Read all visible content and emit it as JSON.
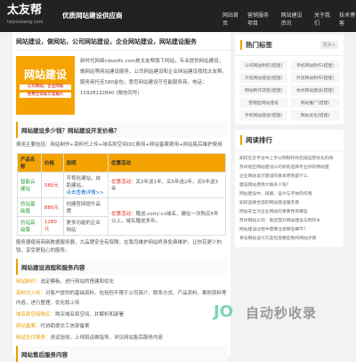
{
  "header": {
    "logo_main": "太友帮",
    "logo_sub": "taiyoubang.com",
    "slogan": "优质网站建设供应商",
    "nav": [
      "网站首页",
      "||",
      "营销服务项目",
      "▾",
      "|",
      "网站建设资讯",
      "|",
      "关于我们",
      "|",
      "技术博客"
    ]
  },
  "main": {
    "heading": "网站建设，做网站，公司网站建设，企业网站建设，网站建设服务",
    "ad": {
      "big": "网站建设",
      "small1": "公司网站，企业网站",
      "small2": "免费咨询拿方案报价"
    },
    "intro": "新时代网络cdsxdfc.com是太友帮旗下网站，专业提供网站建设，做网站等网站建设服务，公司网站建设和企业网站建设我找太友帮。服务用托至580金包，意您网站建设可任能服务商。电话： 15928132840  (微信同号)",
    "q1": "网站建设多少钱？网站建设开发价格？",
    "q1_text": "费用主要包括：网站制作+资料代上传+域名和空间IDC费用+网站备案费用+网站售后维护费用",
    "table": {
      "headers": [
        "产品名称",
        "价格",
        "说明",
        "优惠活动"
      ],
      "rows": [
        {
          "name": "智能云建站",
          "price": "580元",
          "desc1": "可视化建站，自助建站，",
          "desc2": "点击查看详情>>",
          "promo1": "优惠活动：",
          "promo2": "买2年送1年，买5年送2年，买5年送3年"
        },
        {
          "name": "仿站基础版",
          "price": "880元",
          "desc1": "创建官网提升品牌",
          "desc2": "",
          "promo1": "优惠活动：",
          "promo2": "赠送.com/.cn域名，建站一次购买5年以上，域名赠送多年。"
        },
        {
          "name": "仿站高级版",
          "price": "1280元",
          "desc1": "更多功能的企业网站",
          "desc2": "",
          "promo1": "",
          "promo2": ""
        }
      ]
    },
    "promise": "服务器使用商新数据服务器，大品牌安全有保障，在我司维护网站终身免费维护，让你花更少的钱，享受更贴心的服务。",
    "q2": "网站建设流程和服务内容",
    "flow": [
      {
        "label": "网站制作：",
        "text": "选定模板，进行网站的搭建和优化"
      },
      {
        "label": "资料代上传：",
        "text": "对客户提供的基础资料，包括但不限于公司简介、联系方式、产品资料、案例资料等内容，进行整理，优化和上传"
      },
      {
        "label": "域名和空间购买：",
        "text": "购买域名和空间，并解析和部署"
      },
      {
        "label": "网站备案：",
        "text": "代协助提交工信部备案"
      },
      {
        "label": "网站交付服务：",
        "text": "测试验收，上线和运维指导，详见网站售后服务内容"
      }
    ],
    "q3": "网站售后服务内容"
  },
  "sidebar": {
    "hot_title": "热门标签",
    "more": "更多+",
    "tags": [
      "公司网站制作(搭建)",
      "手机网站制作(搭建)",
      "外贸网站建设(搭建)",
      "外贸网站制作(搭建)",
      "网站制作流程(搭建)",
      "杭州网站建设(搭建)",
      "营销型网站建设",
      "网站推广(搭建)",
      "手机网站建设(搭建)",
      "网站优化(搭建)"
    ],
    "rank_title": "阅读排行",
    "rank": [
      "如何在云平台中上手公网制作好后续运营优化的目",
      "苏州地区网站建设公司如何选择专业好的网站建",
      "企业网站设计建设的基本原则是什么",
      "建设网站费用大概多少钱？",
      "网站建设中，排版、设计与字体的作用",
      "如何选择合适的网站建设服务商",
      "网站安全对企业网站的重要性有哪些",
      "苏州网站公司：助您提升网站建设与制作水",
      "网站建设过程中需要注意哪些细节？",
      "青岛网站设计方案包括哪些制作网站步骤"
    ]
  },
  "watermark": {
    "text": "自动秒收录",
    "logo": "JO"
  }
}
